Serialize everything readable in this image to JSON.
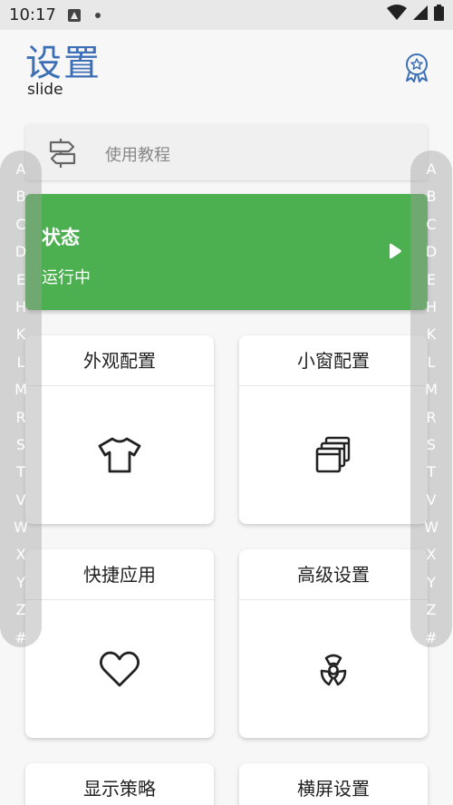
{
  "status_bar": {
    "time": "10:17"
  },
  "header": {
    "title": "设置",
    "subtitle": "slide"
  },
  "tutorial": {
    "label": "使用教程"
  },
  "status_card": {
    "title": "状态",
    "subtitle": "运行中",
    "color": "#4caf50"
  },
  "cards": [
    {
      "label": "外观配置",
      "icon": "tshirt-icon"
    },
    {
      "label": "小窗配置",
      "icon": "windows-icon"
    },
    {
      "label": "快捷应用",
      "icon": "heart-icon"
    },
    {
      "label": "高级设置",
      "icon": "radiation-icon"
    },
    {
      "label": "显示策略",
      "icon": ""
    },
    {
      "label": "横屏设置",
      "icon": ""
    }
  ],
  "index_letters": [
    "A",
    "B",
    "C",
    "D",
    "E",
    "H",
    "K",
    "L",
    "M",
    "R",
    "S",
    "T",
    "V",
    "W",
    "X",
    "Y",
    "Z",
    "#"
  ],
  "colors": {
    "accent": "#3d6fb6",
    "status_green": "#4caf50"
  }
}
